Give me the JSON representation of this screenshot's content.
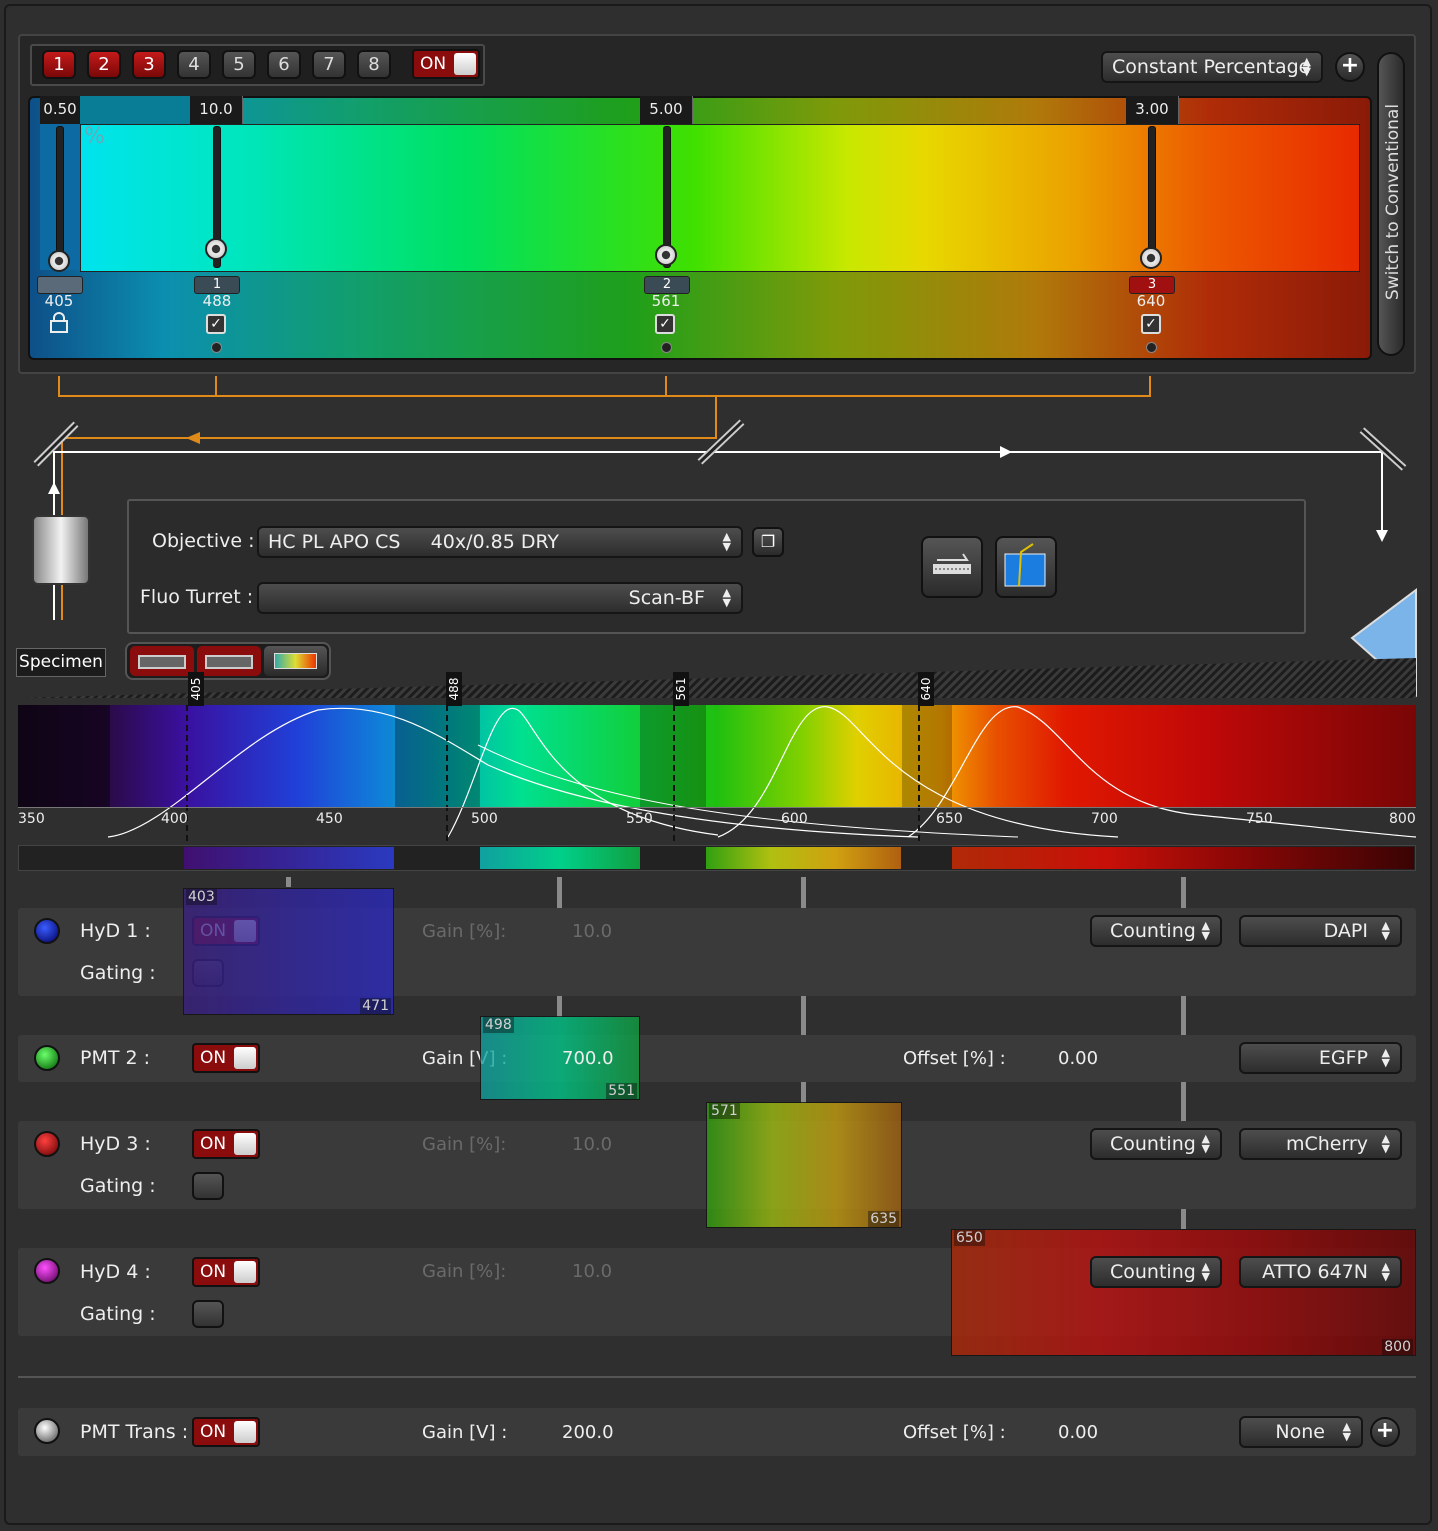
{
  "laser": {
    "tabs": [
      "1",
      "2",
      "3",
      "4",
      "5",
      "6",
      "7",
      "8"
    ],
    "toggle": "ON",
    "mode": "Constant Percentage",
    "switch_label": "Switch to Conventional",
    "percent_symbol": "%",
    "lines": [
      {
        "value": "0.50",
        "wavelength": "405",
        "chip": ""
      },
      {
        "value": "10.0",
        "wavelength": "488",
        "chip": "1"
      },
      {
        "value": "5.00",
        "wavelength": "561",
        "chip": "2"
      },
      {
        "value": "3.00",
        "wavelength": "640",
        "chip": "3"
      }
    ]
  },
  "optics": {
    "specimen": "Specimen",
    "objective_label": "Objective :",
    "objective_value": "HC PL APO CS     40x/0.85 DRY",
    "fluo_label": "Fluo Turret :",
    "fluo_value": "Scan-BF"
  },
  "spectrum": {
    "markers": [
      "405",
      "488",
      "561",
      "640"
    ],
    "axis": [
      "350",
      "400",
      "450",
      "500",
      "550",
      "600",
      "650",
      "700",
      "750",
      "800"
    ]
  },
  "detectors": [
    {
      "name": "HyD 1 :",
      "on": "ON",
      "gating": "Gating :",
      "gain_label": "Gain [%]:",
      "gain": "10.0",
      "mode": "Counting",
      "dye": "DAPI",
      "range": [
        "403",
        "471"
      ]
    },
    {
      "name": "PMT 2 :",
      "on": "ON",
      "gain_label": "Gain [V] :",
      "gain": "700.0",
      "offset_label": "Offset [%] :",
      "offset": "0.00",
      "dye": "EGFP",
      "range": [
        "498",
        "551"
      ]
    },
    {
      "name": "HyD 3 :",
      "on": "ON",
      "gating": "Gating :",
      "gain_label": "Gain [%]:",
      "gain": "10.0",
      "mode": "Counting",
      "dye": "mCherry",
      "range": [
        "571",
        "635"
      ]
    },
    {
      "name": "HyD 4 :",
      "on": "ON",
      "gating": "Gating :",
      "gain_label": "Gain [%]:",
      "gain": "10.0",
      "mode": "Counting",
      "dye": "ATTO 647N",
      "range": [
        "650",
        "800"
      ]
    }
  ],
  "trans": {
    "name": "PMT Trans :",
    "on": "ON",
    "gain_label": "Gain [V] :",
    "gain": "200.0",
    "offset_label": "Offset [%] :",
    "offset": "0.00",
    "dye": "None"
  }
}
